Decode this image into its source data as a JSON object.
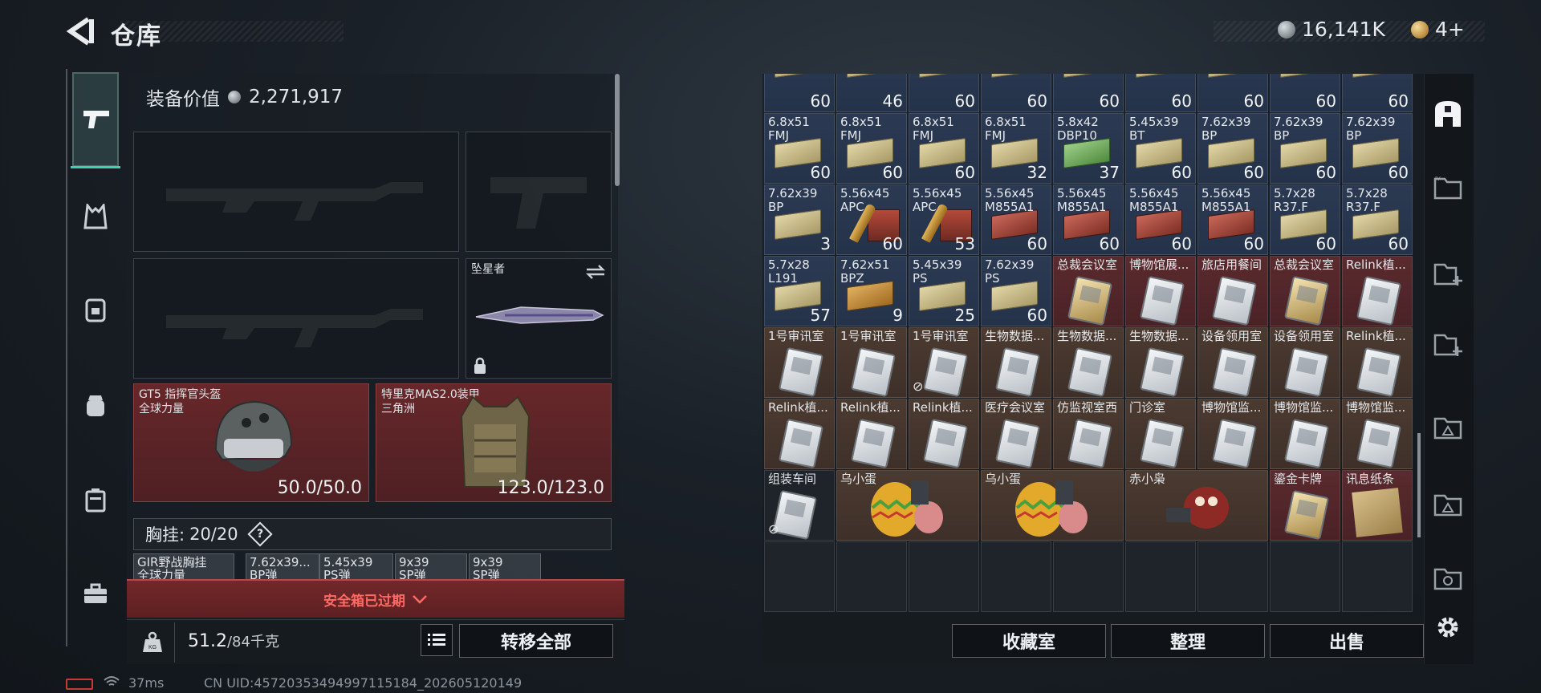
{
  "header": {
    "title": "仓库",
    "currency_silver": "16,141K",
    "currency_gold": "4+"
  },
  "left_nav": {
    "items": [
      "pistol-icon",
      "vest-icon",
      "backpack-icon",
      "pouch-icon",
      "case-icon",
      "toolbox-icon"
    ]
  },
  "equipment": {
    "value_label": "装备价值",
    "value": "2,271,917",
    "melee_name": "坠星者",
    "helmet": {
      "name": "GT5 指挥官头盔",
      "sub": "全球力量",
      "durability": "50.0/50.0"
    },
    "armor": {
      "name": "特里克MAS2.0装甲",
      "sub": "三角洲",
      "durability": "123.0/123.0"
    },
    "chest_label": "胸挂:",
    "chest_value": "20/20",
    "chest_help": "?",
    "mini_slots": [
      {
        "name": "GIR野战胸挂",
        "sub": "全球力量"
      },
      {
        "name": "7.62x39...",
        "sub": "BP弹"
      },
      {
        "name": "5.45x39",
        "sub": "PS弹"
      },
      {
        "name": "9x39",
        "sub": "SP弹"
      },
      {
        "name": "9x39",
        "sub": "SP弹"
      }
    ],
    "safebox_text": "安全箱已过期",
    "weight_current": "51.2",
    "weight_max": "/84千克",
    "transfer_all": "转移全部"
  },
  "inventory": {
    "top_partial_quantities": [
      "60",
      "46",
      "60",
      "60",
      "60",
      "60",
      "60",
      "60",
      "60"
    ],
    "rows": [
      [
        {
          "name": "6.8x51\nFMJ",
          "qty": "60",
          "kind": "ammo",
          "bg": "blue"
        },
        {
          "name": "6.8x51\nFMJ",
          "qty": "60",
          "kind": "ammo",
          "bg": "blue"
        },
        {
          "name": "6.8x51\nFMJ",
          "qty": "60",
          "kind": "ammo",
          "bg": "blue"
        },
        {
          "name": "6.8x51\nFMJ",
          "qty": "32",
          "kind": "ammo",
          "bg": "blue"
        },
        {
          "name": "5.8x42\nDBP10",
          "qty": "37",
          "kind": "ammo-green",
          "bg": "blue"
        },
        {
          "name": "5.45x39\nBT",
          "qty": "60",
          "kind": "ammo",
          "bg": "blue"
        },
        {
          "name": "7.62x39\nBP",
          "qty": "60",
          "kind": "ammo",
          "bg": "blue"
        },
        {
          "name": "7.62x39\nBP",
          "qty": "60",
          "kind": "ammo",
          "bg": "blue"
        },
        {
          "name": "7.62x39\nBP",
          "qty": "60",
          "kind": "ammo",
          "bg": "blue"
        }
      ],
      [
        {
          "name": "7.62x39\nBP",
          "qty": "3",
          "kind": "ammo",
          "bg": "blue"
        },
        {
          "name": "5.56x45\nAPC",
          "qty": "60",
          "kind": "ammo-shell",
          "bg": "blue"
        },
        {
          "name": "5.56x45\nAPC",
          "qty": "53",
          "kind": "ammo-shell",
          "bg": "blue"
        },
        {
          "name": "5.56x45\nM855A1",
          "qty": "60",
          "kind": "ammo-crate",
          "bg": "blue"
        },
        {
          "name": "5.56x45\nM855A1",
          "qty": "60",
          "kind": "ammo-crate",
          "bg": "blue"
        },
        {
          "name": "5.56x45\nM855A1",
          "qty": "60",
          "kind": "ammo-crate",
          "bg": "blue"
        },
        {
          "name": "5.56x45\nM855A1",
          "qty": "60",
          "kind": "ammo-crate",
          "bg": "blue"
        },
        {
          "name": "5.7x28\nR37.F",
          "qty": "60",
          "kind": "ammo",
          "bg": "blue"
        },
        {
          "name": "5.7x28\nR37.F",
          "qty": "60",
          "kind": "ammo",
          "bg": "blue"
        }
      ],
      [
        {
          "name": "5.7x28\nL191",
          "qty": "57",
          "kind": "ammo",
          "bg": "blue"
        },
        {
          "name": "7.62x51\nBPZ",
          "qty": "9",
          "kind": "ammo-orange",
          "bg": "blue"
        },
        {
          "name": "5.45x39\nPS",
          "qty": "25",
          "kind": "ammo",
          "bg": "blue"
        },
        {
          "name": "7.62x39\nPS",
          "qty": "60",
          "kind": "ammo",
          "bg": "blue"
        },
        {
          "name": "总裁会议室",
          "qty": "",
          "kind": "keycard-gold",
          "bg": "red"
        },
        {
          "name": "博物馆展...",
          "qty": "",
          "kind": "keycard",
          "bg": "red"
        },
        {
          "name": "旅店用餐间",
          "qty": "",
          "kind": "keycard",
          "bg": "red"
        },
        {
          "name": "总裁会议室",
          "qty": "",
          "kind": "keycard-gold",
          "bg": "red"
        },
        {
          "name": "Relink植...",
          "qty": "",
          "kind": "keycard",
          "bg": "red"
        }
      ],
      [
        {
          "name": "1号审讯室",
          "qty": "",
          "kind": "keycard",
          "bg": "brown"
        },
        {
          "name": "1号审讯室",
          "qty": "",
          "kind": "keycard",
          "bg": "brown"
        },
        {
          "name": "1号审讯室",
          "qty": "",
          "kind": "keycard",
          "bg": "brown",
          "broken": true
        },
        {
          "name": "生物数据...",
          "qty": "",
          "kind": "keycard",
          "bg": "brown"
        },
        {
          "name": "生物数据...",
          "qty": "",
          "kind": "keycard",
          "bg": "brown"
        },
        {
          "name": "生物数据...",
          "qty": "",
          "kind": "keycard",
          "bg": "brown"
        },
        {
          "name": "设备领用室",
          "qty": "",
          "kind": "keycard",
          "bg": "brown"
        },
        {
          "name": "设备领用室",
          "qty": "",
          "kind": "keycard",
          "bg": "brown"
        },
        {
          "name": "Relink植...",
          "qty": "",
          "kind": "keycard",
          "bg": "brown"
        }
      ],
      [
        {
          "name": "Relink植...",
          "qty": "",
          "kind": "keycard",
          "bg": "brown"
        },
        {
          "name": "Relink植...",
          "qty": "",
          "kind": "keycard",
          "bg": "brown"
        },
        {
          "name": "Relink植...",
          "qty": "",
          "kind": "keycard",
          "bg": "brown"
        },
        {
          "name": "医疗会议室",
          "qty": "",
          "kind": "keycard",
          "bg": "brown"
        },
        {
          "name": "仿监视室西",
          "qty": "",
          "kind": "keycard",
          "bg": "brown"
        },
        {
          "name": "门诊室",
          "qty": "",
          "kind": "keycard",
          "bg": "brown"
        },
        {
          "name": "博物馆监...",
          "qty": "",
          "kind": "keycard",
          "bg": "brown"
        },
        {
          "name": "博物馆监...",
          "qty": "",
          "kind": "keycard",
          "bg": "brown"
        },
        {
          "name": "博物馆监...",
          "qty": "",
          "kind": "keycard",
          "bg": "brown"
        }
      ]
    ],
    "special_row": [
      {
        "name": "组装车间",
        "span": 1,
        "bg": "empty",
        "broken": true
      },
      {
        "name": "乌小蛋",
        "span": 2,
        "bg": "brown"
      },
      {
        "name": "乌小蛋",
        "span": 2,
        "bg": "brown"
      },
      {
        "name": "赤小枭",
        "span": 2,
        "bg": "brown"
      },
      {
        "name": "鎏金卡牌",
        "span": 1,
        "bg": "red"
      },
      {
        "name": "讯息纸条",
        "span": 1,
        "bg": "red"
      }
    ],
    "buttons": {
      "collection": "收藏室",
      "sort": "整理",
      "sell": "出售"
    }
  },
  "right_sidebar": {
    "items": [
      "vault-icon",
      "folder-icon",
      "add-container-icon",
      "add-container-icon",
      "triangle-container-icon",
      "triangle-container-icon",
      "container-icon"
    ]
  },
  "status": {
    "ping": "37ms",
    "uid": "CN UID:45720353494997115184_202605120149"
  }
}
